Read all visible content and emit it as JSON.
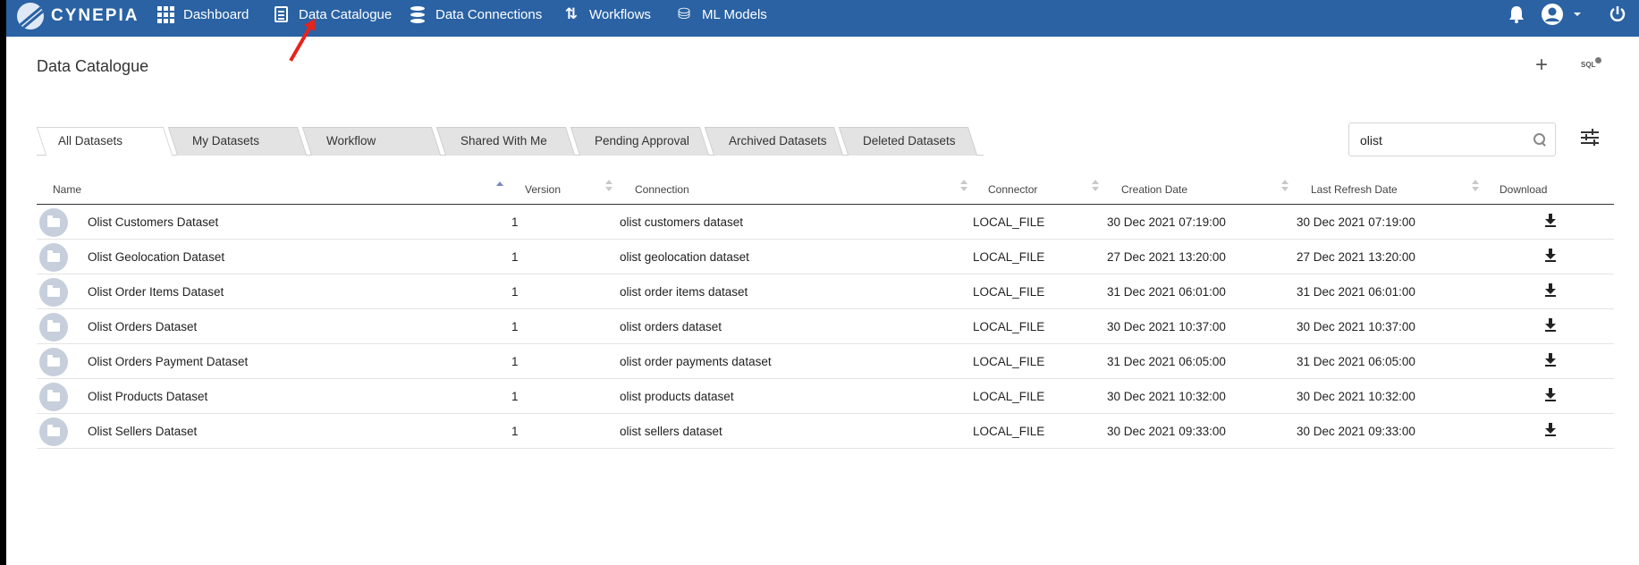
{
  "brand": {
    "name": "CYNEPIA"
  },
  "nav": {
    "items": [
      {
        "label": "Dashboard",
        "icon": "grid-icon"
      },
      {
        "label": "Data Catalogue",
        "icon": "document-icon"
      },
      {
        "label": "Data Connections",
        "icon": "database-icon"
      },
      {
        "label": "Workflows",
        "icon": "workflow-icon"
      },
      {
        "label": "ML Models",
        "icon": "ml-models-icon"
      }
    ],
    "right_icons": [
      "bell-icon",
      "user-account-icon",
      "chevron-down-icon",
      "power-icon"
    ]
  },
  "page": {
    "title": "Data Catalogue",
    "add_symbol": "+",
    "sql_label": "SQL"
  },
  "tabs": [
    {
      "label": "All Datasets",
      "active": true
    },
    {
      "label": "My Datasets",
      "active": false
    },
    {
      "label": "Workflow",
      "active": false
    },
    {
      "label": "Shared With Me",
      "active": false
    },
    {
      "label": "Pending Approval",
      "active": false
    },
    {
      "label": "Archived Datasets",
      "active": false
    },
    {
      "label": "Deleted Datasets",
      "active": false
    }
  ],
  "search": {
    "value": "olist",
    "placeholder": ""
  },
  "table": {
    "headers": {
      "name": "Name",
      "version": "Version",
      "connection": "Connection",
      "connector": "Connector",
      "creation_date": "Creation Date",
      "last_refresh_date": "Last Refresh Date",
      "download": "Download"
    },
    "sorted_by": "name",
    "rows": [
      {
        "name": "Olist Customers Dataset",
        "version": "1",
        "connection": "olist customers dataset",
        "connector": "LOCAL_FILE",
        "creation_date": "30 Dec 2021 07:19:00",
        "last_refresh_date": "30 Dec 2021 07:19:00"
      },
      {
        "name": "Olist Geolocation Dataset",
        "version": "1",
        "connection": "olist geolocation dataset",
        "connector": "LOCAL_FILE",
        "creation_date": "27 Dec 2021 13:20:00",
        "last_refresh_date": "27 Dec 2021 13:20:00"
      },
      {
        "name": "Olist Order Items Dataset",
        "version": "1",
        "connection": "olist order items dataset",
        "connector": "LOCAL_FILE",
        "creation_date": "31 Dec 2021 06:01:00",
        "last_refresh_date": "31 Dec 2021 06:01:00"
      },
      {
        "name": "Olist Orders Dataset",
        "version": "1",
        "connection": "olist orders dataset",
        "connector": "LOCAL_FILE",
        "creation_date": "30 Dec 2021 10:37:00",
        "last_refresh_date": "30 Dec 2021 10:37:00"
      },
      {
        "name": "Olist Orders Payment Dataset",
        "version": "1",
        "connection": "olist order payments dataset",
        "connector": "LOCAL_FILE",
        "creation_date": "31 Dec 2021 06:05:00",
        "last_refresh_date": "31 Dec 2021 06:05:00"
      },
      {
        "name": "Olist Products Dataset",
        "version": "1",
        "connection": "olist products dataset",
        "connector": "LOCAL_FILE",
        "creation_date": "30 Dec 2021 10:32:00",
        "last_refresh_date": "30 Dec 2021 10:32:00"
      },
      {
        "name": "Olist Sellers Dataset",
        "version": "1",
        "connection": "olist sellers dataset",
        "connector": "LOCAL_FILE",
        "creation_date": "30 Dec 2021 09:33:00",
        "last_refresh_date": "30 Dec 2021 09:33:00"
      }
    ]
  },
  "colors": {
    "topbar": "#2a62a3",
    "annotation_arrow": "#e8231b",
    "sort_active": "#7b85c8",
    "folder_badge": "#c6cfdb"
  }
}
